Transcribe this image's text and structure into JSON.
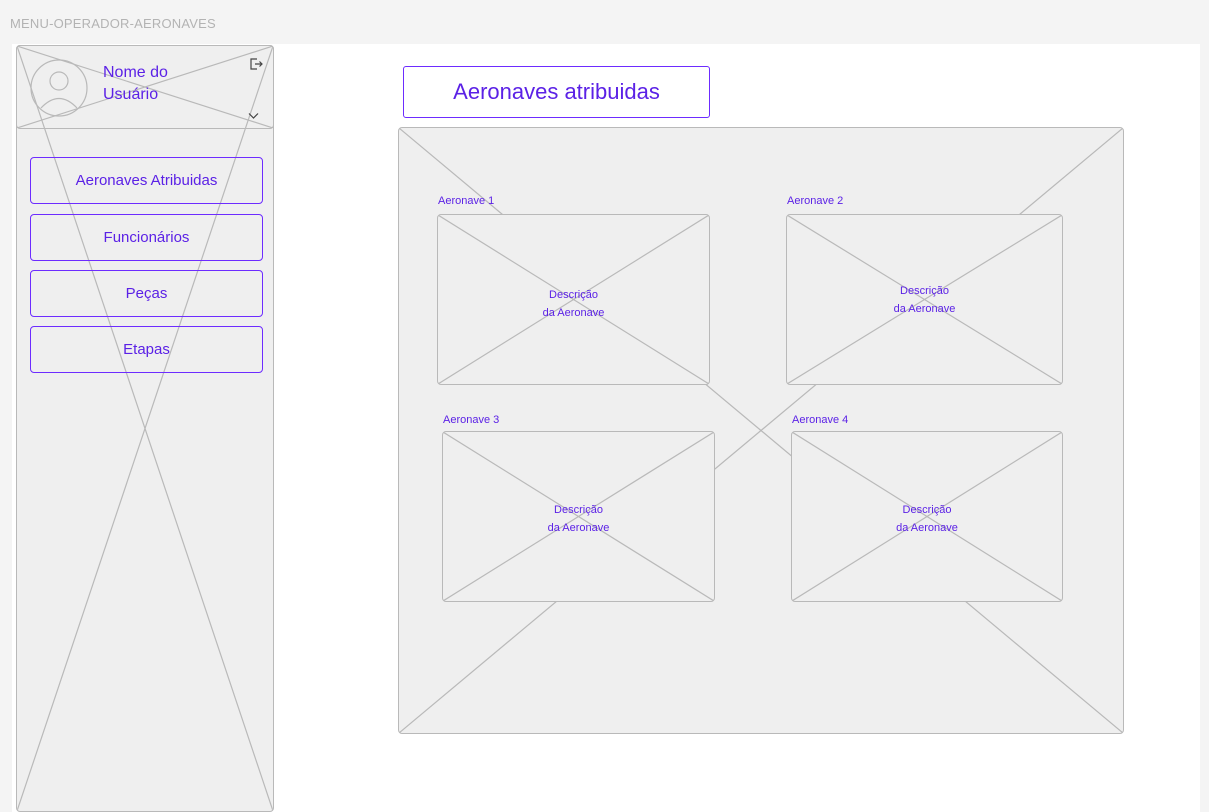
{
  "frame": {
    "label": "MENU-OPERADOR-AERONAVES"
  },
  "user": {
    "name_line1": "Nome do",
    "name_line2": "Usuário"
  },
  "sidebar": {
    "items": [
      {
        "label": "Aeronaves Atribuidas"
      },
      {
        "label": "Funcionários"
      },
      {
        "label": "Peças"
      },
      {
        "label": "Etapas"
      }
    ]
  },
  "main": {
    "title": "Aeronaves atribuidas",
    "cards": [
      {
        "label": "Aeronave 1",
        "desc_line1": "Descrição",
        "desc_line2": "da Aeronave"
      },
      {
        "label": "Aeronave 2",
        "desc_line1": "Descrição",
        "desc_line2": "da Aeronave"
      },
      {
        "label": "Aeronave 3",
        "desc_line1": "Descrição",
        "desc_line2": "da Aeronave"
      },
      {
        "label": "Aeronave 4",
        "desc_line1": "Descrição",
        "desc_line2": "da Aeronave"
      }
    ]
  },
  "icons": {
    "avatar": "user-avatar-icon",
    "logout": "logout-icon",
    "chevron": "chevron-down-icon"
  },
  "colors": {
    "accent": "#5b21e6",
    "border": "#6d2cff",
    "placeholder": "#efefef",
    "stroke": "#b9b9b9"
  }
}
